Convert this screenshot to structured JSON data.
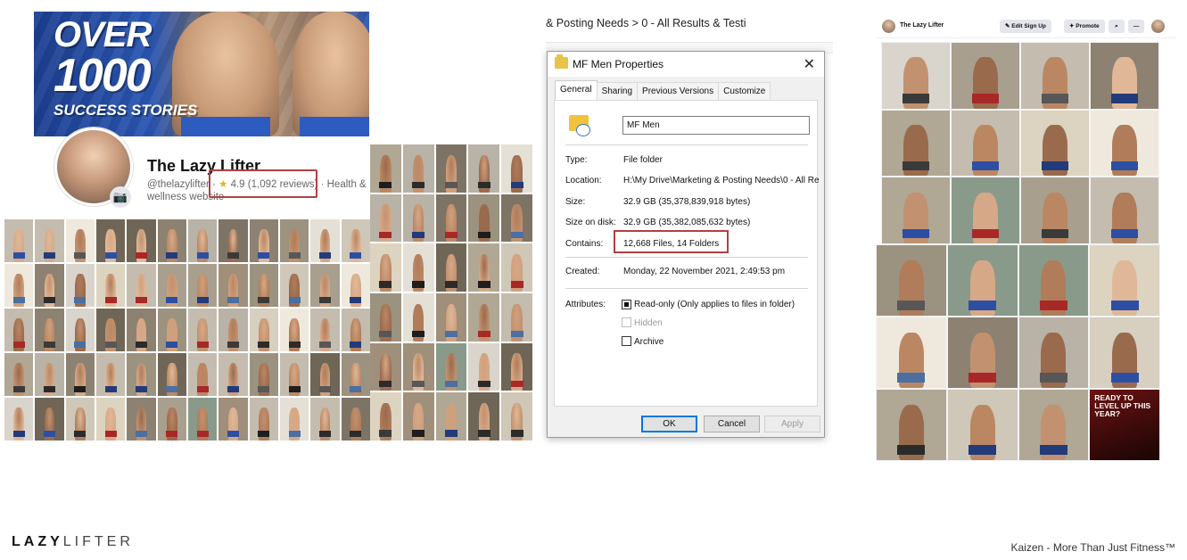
{
  "fb_page": {
    "cover_line1": "OVER",
    "cover_line2": "1000",
    "cover_line3": "SUCCESS STORIES",
    "name": "The Lazy Lifter",
    "handle": "@thelazylifter",
    "rating": "4.9 (1,092 reviews)",
    "category": "Health & wellness website",
    "camera_icon": "camera-icon"
  },
  "explorer": {
    "breadcrumb": "& Posting Needs  >  0 - All Results & Testi"
  },
  "properties_dialog": {
    "title": "MF Men Properties",
    "tabs": [
      "General",
      "Sharing",
      "Previous Versions",
      "Customize"
    ],
    "folder_name": "MF Men",
    "rows": [
      {
        "label": "Type:",
        "value": "File folder"
      },
      {
        "label": "Location:",
        "value": "H:\\My Drive\\Marketing & Posting Needs\\0 - All Re"
      },
      {
        "label": "Size:",
        "value": "32.9 GB (35,378,839,918 bytes)"
      },
      {
        "label": "Size on disk:",
        "value": "32.9 GB (35,382,085,632 bytes)"
      },
      {
        "label": "Contains:",
        "value": "12,668 Files, 14 Folders"
      },
      {
        "label": "Created:",
        "value": "Monday, 22 November 2021, 2:49:53 pm"
      }
    ],
    "attributes_label": "Attributes:",
    "attributes": [
      {
        "label": "Read-only (Only applies to files in folder)",
        "checked": true,
        "disabled": false
      },
      {
        "label": "Hidden",
        "checked": false,
        "disabled": true
      },
      {
        "label": "Archive",
        "checked": false,
        "disabled": false
      }
    ],
    "buttons": {
      "ok": "OK",
      "cancel": "Cancel",
      "apply": "Apply"
    }
  },
  "right_panel": {
    "page_name": "The Lazy Lifter",
    "edit_signup": "✎ Edit Sign Up",
    "promote": "✦ Promote",
    "ad_headline": "READY TO LEVEL UP THIS YEAR?"
  },
  "footer": {
    "brand_bold": "LAZY",
    "brand_light": "LIFTER",
    "tagline": "Kaizen - More Than Just Fitness™"
  },
  "colors": {
    "highlight_box": "#b04040",
    "fb_blue": "#2a56b3",
    "win_accent": "#0078d7"
  }
}
